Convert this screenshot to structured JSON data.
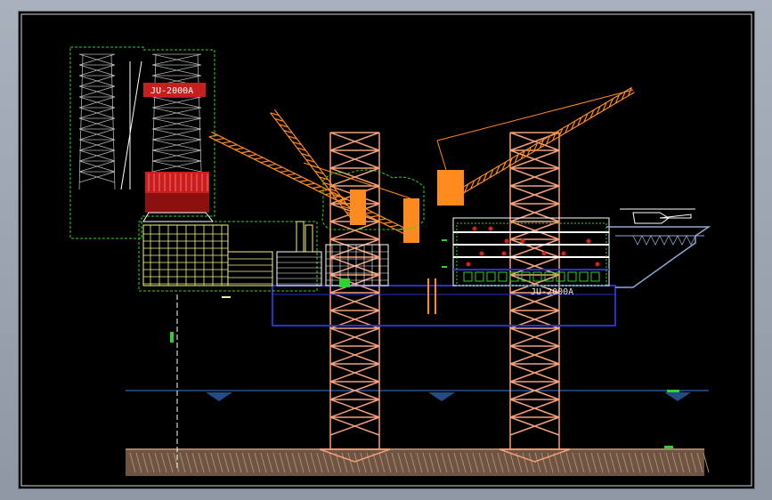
{
  "drawing": {
    "title_inset_label": "JU-2000A",
    "hull_label": "JU-2000A"
  },
  "colors": {
    "background": "#000000",
    "leg_truss": "#f4a07a",
    "crane": "#ff8a1e",
    "derrick": "#c81e1e",
    "deck_structure": "#f2f28c",
    "hull_outline": "#2832c8",
    "cloud_outline": "#2fd12f",
    "seabed": "#8a6a55",
    "sea_line": "#3a7de0",
    "helideck": "#8fa7d6"
  }
}
